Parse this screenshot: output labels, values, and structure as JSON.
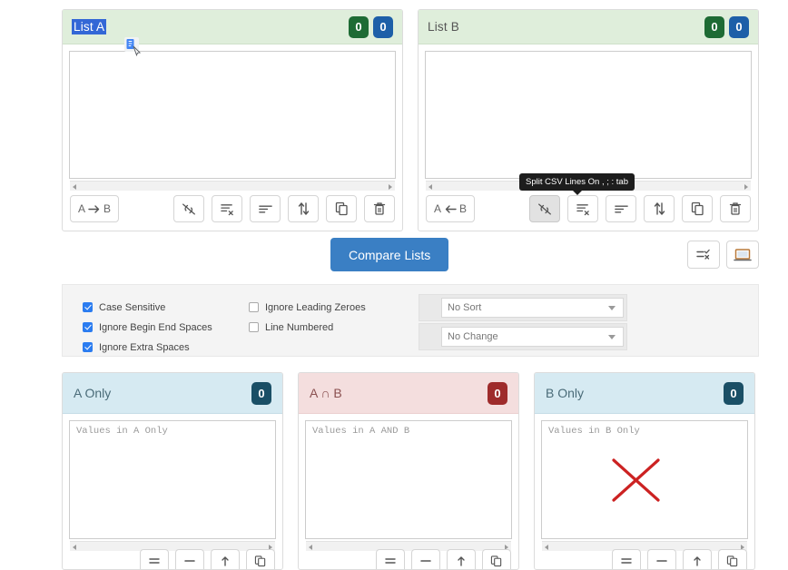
{
  "lists": [
    {
      "id": "a",
      "title": "List A",
      "selected": true,
      "badge_count_1": "0",
      "badge_count_2": "0",
      "textarea_value": "",
      "transfer_label_left": "A",
      "transfer_label_right": "B",
      "transfer_direction": "right",
      "tools": [
        {
          "name": "split-csv-icon",
          "label": "Split CSV Lines On , ; : tab",
          "active": false
        },
        {
          "name": "remove-duplicates-icon",
          "label": "Remove Duplicates"
        },
        {
          "name": "trim-lines-icon",
          "label": "Trim Lines"
        },
        {
          "name": "sort-toggle-icon",
          "label": "Sort"
        },
        {
          "name": "copy-icon",
          "label": "Copy"
        },
        {
          "name": "trash-icon",
          "label": "Clear"
        }
      ]
    },
    {
      "id": "b",
      "title": "List B",
      "selected": false,
      "badge_count_1": "0",
      "badge_count_2": "0",
      "textarea_value": "",
      "transfer_label_left": "A",
      "transfer_label_right": "B",
      "transfer_direction": "left",
      "tools": [
        {
          "name": "split-csv-icon",
          "label": "Split CSV Lines On , ; : tab",
          "active": true
        },
        {
          "name": "remove-duplicates-icon",
          "label": "Remove Duplicates"
        },
        {
          "name": "trim-lines-icon",
          "label": "Trim Lines"
        },
        {
          "name": "sort-toggle-icon",
          "label": "Sort"
        },
        {
          "name": "copy-icon",
          "label": "Copy"
        },
        {
          "name": "trash-icon",
          "label": "Clear"
        }
      ]
    }
  ],
  "tooltip": {
    "text": "Split CSV Lines On , ; : tab",
    "visible": true
  },
  "compare": {
    "button_label": "Compare Lists",
    "button_color": "#3a7fc4",
    "side_tools": [
      {
        "name": "compare-options-icon",
        "label": "Options"
      },
      {
        "name": "fullscreen-icon",
        "label": "Full Screen"
      }
    ]
  },
  "options": {
    "checkboxes_left": [
      {
        "label": "Case Sensitive",
        "checked": true
      },
      {
        "label": "Ignore Begin End Spaces",
        "checked": true
      },
      {
        "label": "Ignore Extra Spaces",
        "checked": true
      }
    ],
    "checkboxes_right": [
      {
        "label": "Ignore Leading Zeroes",
        "checked": false
      },
      {
        "label": "Line Numbered",
        "checked": false
      }
    ],
    "selects": [
      {
        "name": "sort-select",
        "value": "No Sort"
      },
      {
        "name": "case-select",
        "value": "No Change"
      }
    ]
  },
  "results": [
    {
      "id": "a-only",
      "title": "A Only",
      "theme": "blue",
      "count": "0",
      "placeholder": "Values in A Only",
      "tools": [
        {
          "name": "lines-icon",
          "label": "Lines"
        },
        {
          "name": "minus-icon",
          "label": "Minus"
        },
        {
          "name": "move-up-icon",
          "label": "Move Up"
        },
        {
          "name": "copy-icon",
          "label": "Copy"
        }
      ]
    },
    {
      "id": "a-and-b",
      "title": "A ∩ B",
      "theme": "red",
      "count": "0",
      "placeholder": "Values in A AND B",
      "tools": [
        {
          "name": "lines-icon",
          "label": "Lines"
        },
        {
          "name": "minus-icon",
          "label": "Minus"
        },
        {
          "name": "move-up-icon",
          "label": "Move Up"
        },
        {
          "name": "copy-icon",
          "label": "Copy"
        }
      ]
    },
    {
      "id": "b-only",
      "title": "B Only",
      "theme": "blue",
      "count": "0",
      "placeholder": "Values in B Only",
      "tools": [
        {
          "name": "lines-icon",
          "label": "Lines"
        },
        {
          "name": "minus-icon",
          "label": "Minus"
        },
        {
          "name": "move-up-icon",
          "label": "Move Up"
        },
        {
          "name": "copy-icon",
          "label": "Copy"
        }
      ]
    }
  ],
  "annotations": {
    "x_mark_color": "#cc2222",
    "drag_cursor": "copy-drag-cursor"
  }
}
